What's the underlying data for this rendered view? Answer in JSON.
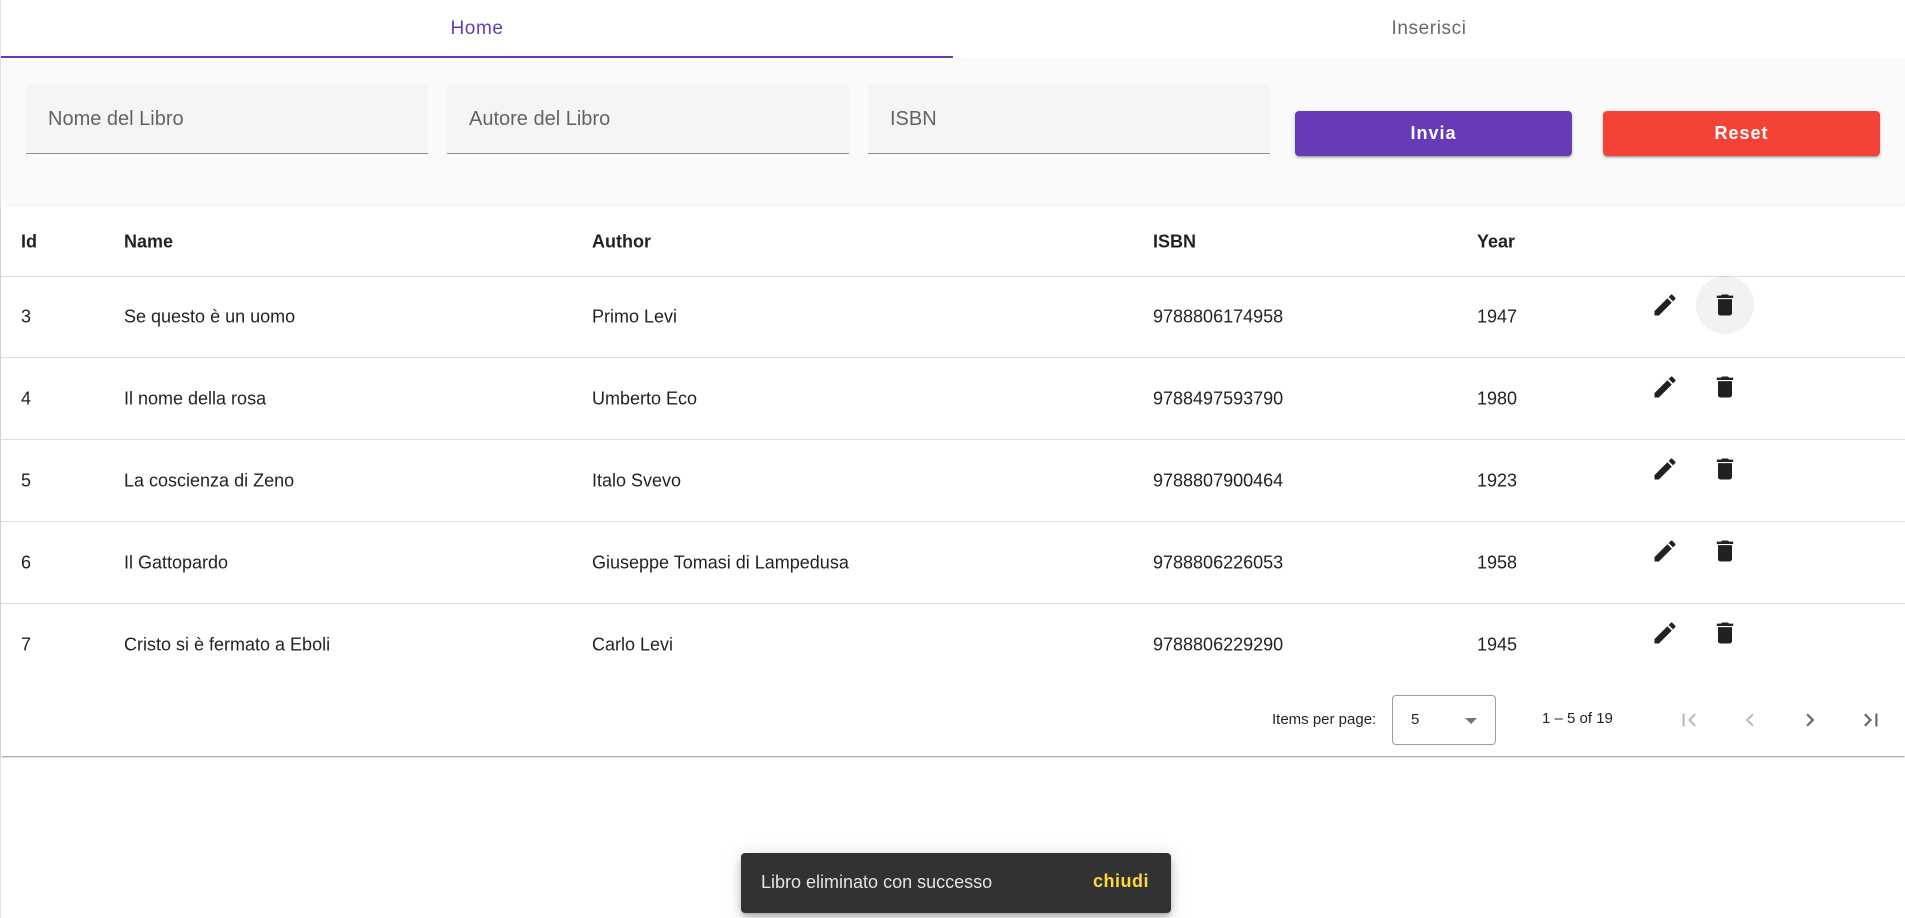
{
  "tabs": [
    {
      "label": "Home",
      "active": true
    },
    {
      "label": "Inserisci",
      "active": false
    }
  ],
  "form": {
    "name_placeholder": "Nome del Libro",
    "author_placeholder": "Autore del Libro",
    "isbn_placeholder": "ISBN",
    "name_value": "",
    "author_value": "",
    "isbn_value": "",
    "submit_label": "Invia",
    "reset_label": "Reset"
  },
  "table": {
    "headers": {
      "id": "Id",
      "name": "Name",
      "author": "Author",
      "isbn": "ISBN",
      "year": "Year"
    },
    "rows": [
      {
        "id": "3",
        "name": "Se questo è un uomo",
        "author": "Primo Levi",
        "isbn": "9788806174958",
        "year": "1947"
      },
      {
        "id": "4",
        "name": "Il nome della rosa",
        "author": "Umberto Eco",
        "isbn": "9788497593790",
        "year": "1980"
      },
      {
        "id": "5",
        "name": "La coscienza di Zeno",
        "author": "Italo Svevo",
        "isbn": "9788807900464",
        "year": "1923"
      },
      {
        "id": "6",
        "name": "Il Gattopardo",
        "author": "Giuseppe Tomasi di Lampedusa",
        "isbn": "9788806226053",
        "year": "1958"
      },
      {
        "id": "7",
        "name": "Cristo si è fermato a Eboli",
        "author": "Carlo Levi",
        "isbn": "9788806229290",
        "year": "1945"
      }
    ],
    "row_actions": [
      "edit-icon",
      "delete-icon"
    ]
  },
  "paginator": {
    "items_per_page_label": "Items per page:",
    "page_size": "5",
    "range_label": "1 – 5 of 19",
    "first_enabled": false,
    "prev_enabled": false,
    "next_enabled": true,
    "last_enabled": true
  },
  "snackbar": {
    "message": "Libro eliminato con successo",
    "action": "chiudi"
  },
  "colors": {
    "primary": "#673ab7",
    "warn": "#f44336",
    "snackbar_bg": "#323232",
    "snackbar_action": "#ffd740"
  }
}
